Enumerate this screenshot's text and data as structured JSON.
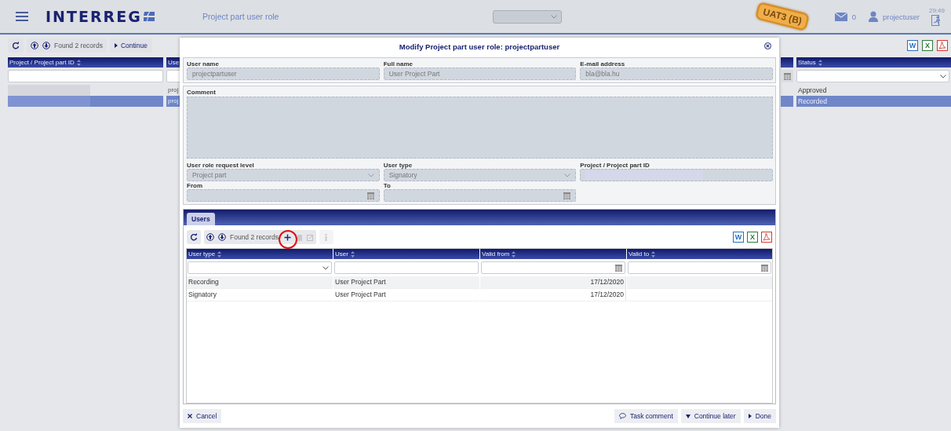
{
  "header": {
    "logo": "INTERREG",
    "app_title": "Project part user role",
    "env_badge": "UAT3 (B)",
    "message_count": "0",
    "username": "projectuser",
    "session_time": "29:49"
  },
  "list": {
    "found": "Found 2 records",
    "continue": "Continue",
    "columns": [
      "Project / Project part ID",
      "Use"
    ],
    "status_column": "Status",
    "rows": [
      {
        "column_2": "proj",
        "status": "Approved",
        "selected": false
      },
      {
        "column_2": "proj",
        "status": "Recorded",
        "selected": true
      }
    ],
    "exports": [
      {
        "kind": "word",
        "label": "W"
      },
      {
        "kind": "excel",
        "label": "X"
      },
      {
        "kind": "pdf"
      }
    ]
  },
  "dialog": {
    "title": "Modify Project part user role: projectpartuser",
    "fields": [
      {
        "label": "User name",
        "value": "projectpartuser",
        "kind": "text"
      },
      {
        "label": "Full name",
        "value": "User Project Part",
        "kind": "text"
      },
      {
        "label": "E-mail address",
        "value": "bla@bla.hu",
        "kind": "text"
      }
    ],
    "comment": {
      "label": "Comment"
    },
    "fields_2": [
      {
        "label": "User role request level",
        "value": "Project part",
        "kind": "select"
      },
      {
        "label": "User type",
        "value": "Signatory",
        "kind": "select"
      },
      {
        "label": "Project / Project part ID",
        "kind": "redacted"
      },
      {
        "label": "From",
        "kind": "date"
      },
      {
        "label": "To",
        "kind": "date"
      }
    ],
    "tabs": [
      {
        "label": "Users",
        "selected": true
      }
    ],
    "users": {
      "found": "Found 2 records",
      "add_highlighted": true,
      "columns": [
        {
          "label": "User type",
          "kind": "select"
        },
        {
          "label": "User",
          "kind": "text"
        },
        {
          "label": "Valid from",
          "kind": "date"
        },
        {
          "label": "Valid to",
          "kind": "date"
        }
      ],
      "rows": [
        {
          "user_type": "Recording",
          "user": "User Project Part",
          "valid_from": "17/12/2020"
        },
        {
          "user_type": "Signatory",
          "user": "User Project Part",
          "valid_from": "17/12/2020"
        }
      ],
      "exports": [
        {
          "kind": "word",
          "label": "W"
        },
        {
          "kind": "excel",
          "label": "X"
        },
        {
          "kind": "pdf"
        }
      ]
    },
    "footer": {
      "left": [
        {
          "label": "Cancel",
          "kind": "cancel"
        }
      ],
      "right": [
        {
          "label": "Task comment",
          "kind": "comment"
        },
        {
          "label": "Continue later",
          "kind": "later"
        },
        {
          "label": "Done",
          "kind": "done"
        }
      ]
    }
  }
}
